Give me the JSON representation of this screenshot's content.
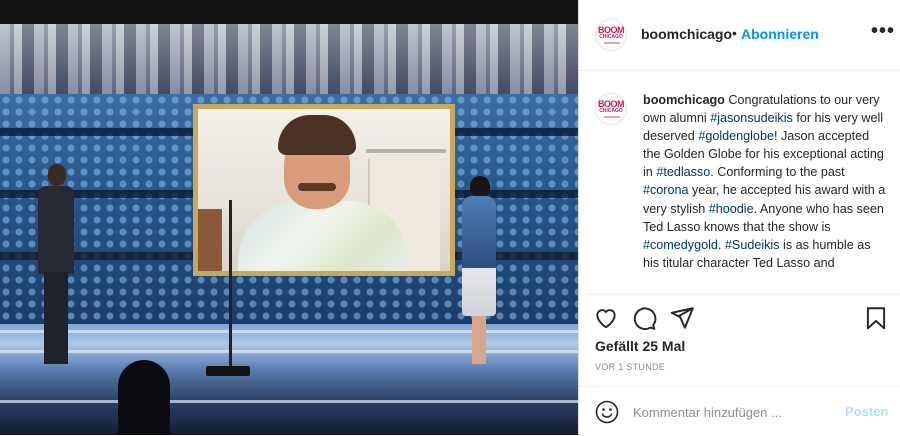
{
  "header": {
    "username": "boomchicago",
    "separator": "•",
    "follow_label": "Abonnieren",
    "more_label": "•••"
  },
  "avatar": {
    "logo_line1": "BOOM",
    "logo_line2": "CHICAGO"
  },
  "caption": {
    "username": "boomchicago",
    "segments": [
      {
        "text": " Congratulations to our very own alumni ",
        "tag": false
      },
      {
        "text": "#jasonsudeikis",
        "tag": true
      },
      {
        "text": " for his very well deserved ",
        "tag": false
      },
      {
        "text": "#goldenglobe",
        "tag": true
      },
      {
        "text": "! Jason accepted the Golden Globe for his exceptional acting in ",
        "tag": false
      },
      {
        "text": "#tedlasso",
        "tag": true
      },
      {
        "text": ". Conforming to the past ",
        "tag": false
      },
      {
        "text": "#corona",
        "tag": true
      },
      {
        "text": " year, he accepted his award with a very stylish ",
        "tag": false
      },
      {
        "text": "#hoodie",
        "tag": true
      },
      {
        "text": ". Anyone who has seen Ted Lasso knows that the show is ",
        "tag": false
      },
      {
        "text": "#comedygold",
        "tag": true
      },
      {
        "text": ". ",
        "tag": false
      },
      {
        "text": "#Sudeikis",
        "tag": true
      },
      {
        "text": " is as humble as his titular character Ted Lasso and",
        "tag": false
      }
    ]
  },
  "actions": {
    "like_icon": "heart-icon",
    "comment_icon": "comment-bubble-icon",
    "share_icon": "paper-plane-icon",
    "save_icon": "bookmark-icon"
  },
  "likes_text": "Gefällt 25 Mal",
  "timestamp": "VOR 1 STUNDE",
  "comment": {
    "placeholder": "Kommentar hinzufügen ...",
    "post_label": "Posten",
    "emoji_icon": "smiley-icon"
  },
  "colors": {
    "link_blue": "#0095f6",
    "hashtag": "#00376b",
    "post_disabled": "#b2dffc",
    "brand_pink": "#d4145a"
  }
}
